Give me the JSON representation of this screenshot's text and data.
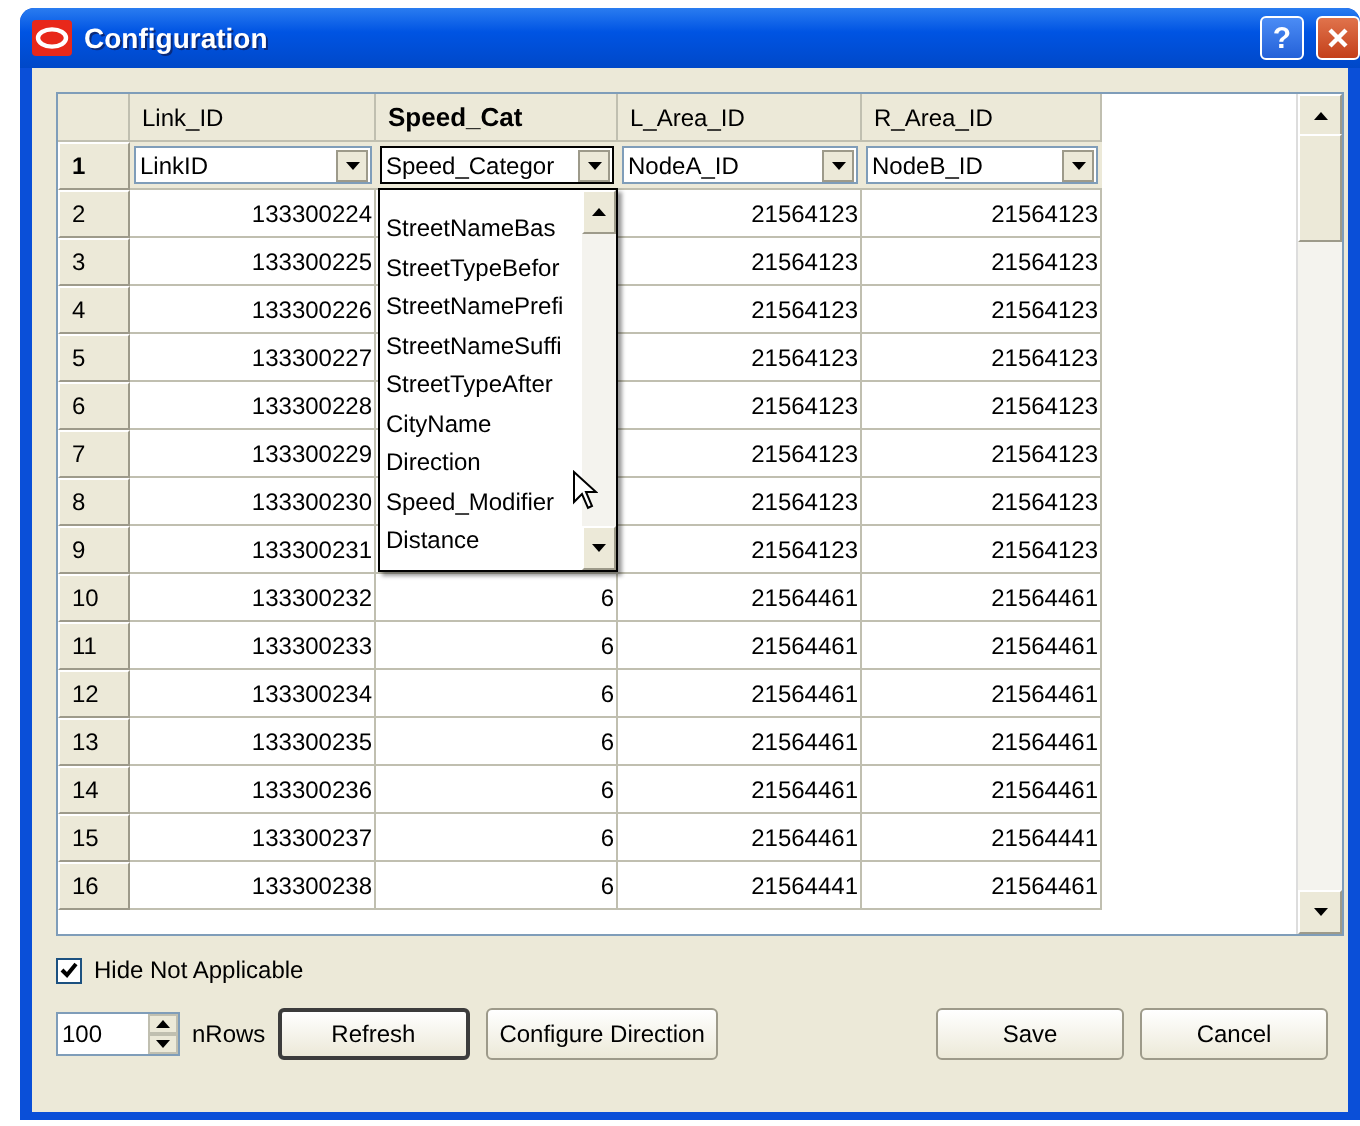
{
  "window": {
    "title": "Configuration",
    "help": "?"
  },
  "grid": {
    "columns": [
      {
        "label": "Link_ID",
        "selected": false
      },
      {
        "label": "Speed_Cat",
        "selected": true
      },
      {
        "label": "L_Area_ID",
        "selected": false
      },
      {
        "label": "R_Area_ID",
        "selected": false
      }
    ],
    "mapping_row": {
      "number": "1",
      "dropdowns": [
        {
          "value": "LinkID",
          "open": false
        },
        {
          "value": "Speed_Categor",
          "open": true
        },
        {
          "value": "NodeA_ID",
          "open": false
        },
        {
          "value": "NodeB_ID",
          "open": false
        }
      ]
    },
    "rows": [
      {
        "number": "2",
        "link_id": "133300224",
        "l_area_id": "21564123",
        "r_area_id": "21564123"
      },
      {
        "number": "3",
        "link_id": "133300225",
        "l_area_id": "21564123",
        "r_area_id": "21564123"
      },
      {
        "number": "4",
        "link_id": "133300226",
        "l_area_id": "21564123",
        "r_area_id": "21564123"
      },
      {
        "number": "5",
        "link_id": "133300227",
        "l_area_id": "21564123",
        "r_area_id": "21564123"
      },
      {
        "number": "6",
        "link_id": "133300228",
        "l_area_id": "21564123",
        "r_area_id": "21564123"
      },
      {
        "number": "7",
        "link_id": "133300229",
        "l_area_id": "21564123",
        "r_area_id": "21564123"
      },
      {
        "number": "8",
        "link_id": "133300230",
        "l_area_id": "21564123",
        "r_area_id": "21564123"
      },
      {
        "number": "9",
        "link_id": "133300231",
        "l_area_id": "21564123",
        "r_area_id": "21564123"
      },
      {
        "number": "10",
        "link_id": "133300232",
        "speed_cat": "6",
        "l_area_id": "21564461",
        "r_area_id": "21564461"
      },
      {
        "number": "11",
        "link_id": "133300233",
        "speed_cat": "6",
        "l_area_id": "21564461",
        "r_area_id": "21564461"
      },
      {
        "number": "12",
        "link_id": "133300234",
        "speed_cat": "6",
        "l_area_id": "21564461",
        "r_area_id": "21564461"
      },
      {
        "number": "13",
        "link_id": "133300235",
        "speed_cat": "6",
        "l_area_id": "21564461",
        "r_area_id": "21564461"
      },
      {
        "number": "14",
        "link_id": "133300236",
        "speed_cat": "6",
        "l_area_id": "21564461",
        "r_area_id": "21564461"
      },
      {
        "number": "15",
        "link_id": "133300237",
        "speed_cat": "6",
        "l_area_id": "21564461",
        "r_area_id": "21564441"
      },
      {
        "number": "16",
        "link_id": "133300238",
        "speed_cat": "6",
        "l_area_id": "21564441",
        "r_area_id": "21564461"
      }
    ],
    "open_list": {
      "items": [
        "StreetNameBas",
        "StreetTypeBefor",
        "StreetNamePrefi",
        "StreetNameSuffi",
        "StreetTypeAfter",
        "CityName",
        "Direction",
        "Speed_Modifier",
        "Distance"
      ]
    }
  },
  "hide_not_applicable": {
    "label": "Hide Not Applicable",
    "checked": true
  },
  "rows_spinner": {
    "value": "100",
    "label": "nRows"
  },
  "left_buttons": [
    {
      "label": "Refresh",
      "default": true
    },
    {
      "label": "Configure Direction",
      "default": false
    }
  ],
  "right_buttons": [
    {
      "label": "Save",
      "default": false
    },
    {
      "label": "Cancel",
      "default": false
    }
  ]
}
